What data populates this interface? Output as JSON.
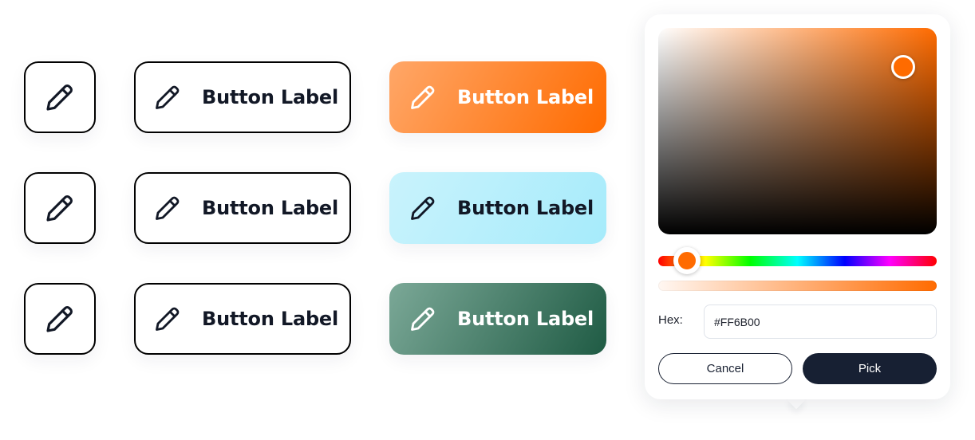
{
  "button_label": "Button Label",
  "icon": "pencil-icon",
  "themes": {
    "orange": {
      "accent": "#FF7F1A",
      "fill_start": "#FFA768",
      "fill_end": "#FF6B00"
    },
    "cyan": {
      "accent": "#7FE0F7",
      "fill_start": "#C9F3FC",
      "fill_end": "#A6EBFB"
    },
    "green": {
      "accent": "#1E5B45",
      "fill_start": "#7BA897",
      "fill_end": "#1F5B44"
    }
  },
  "picker": {
    "hex_label": "Hex:",
    "hex_value": "#FF6B00",
    "cancel_label": "Cancel",
    "pick_label": "Pick",
    "selected_color": "#FF6B00"
  }
}
